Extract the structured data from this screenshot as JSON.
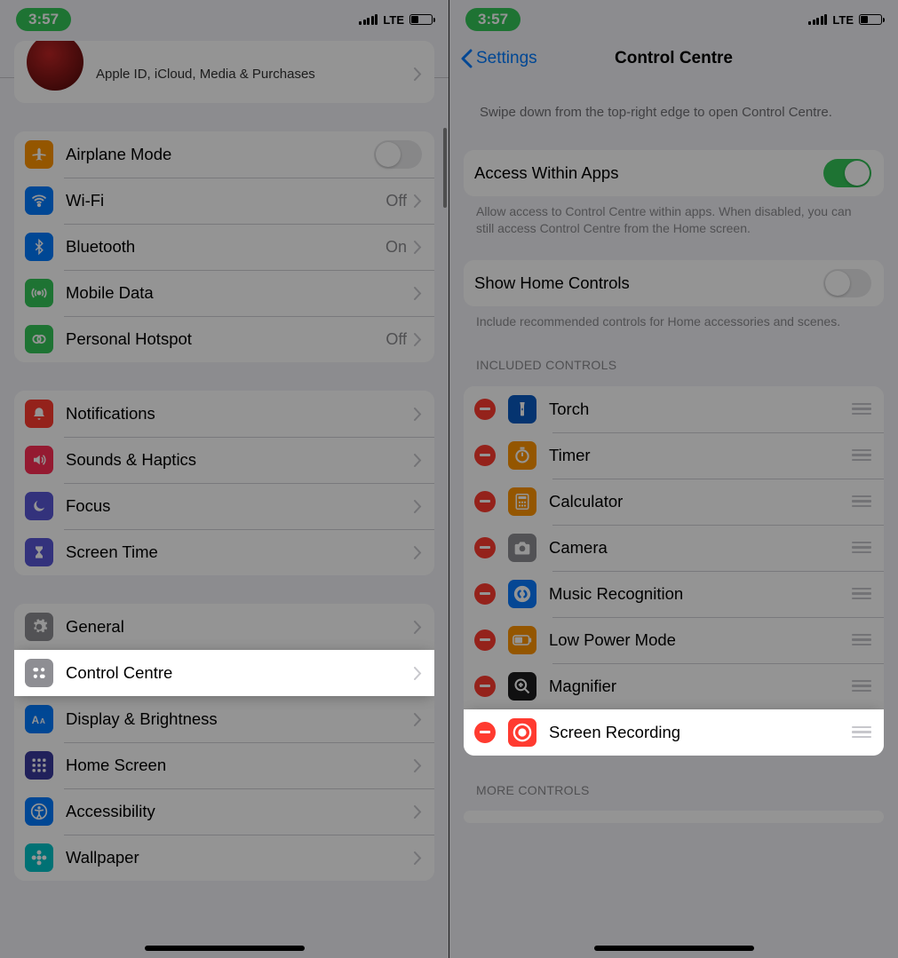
{
  "status": {
    "time": "3:57",
    "carrier": "LTE"
  },
  "left": {
    "title": "Settings",
    "profile_sub": "Apple ID, iCloud, Media & Purchases",
    "group1": [
      {
        "label": "Airplane Mode",
        "icon": "airplane",
        "bg": "#ff9500",
        "switch": false
      },
      {
        "label": "Wi-Fi",
        "icon": "wifi",
        "bg": "#007aff",
        "value": "Off"
      },
      {
        "label": "Bluetooth",
        "icon": "bluetooth",
        "bg": "#007aff",
        "value": "On"
      },
      {
        "label": "Mobile Data",
        "icon": "antenna",
        "bg": "#34c759"
      },
      {
        "label": "Personal Hotspot",
        "icon": "hotspot",
        "bg": "#34c759",
        "value": "Off"
      }
    ],
    "group2": [
      {
        "label": "Notifications",
        "icon": "bell",
        "bg": "#ff3b30"
      },
      {
        "label": "Sounds & Haptics",
        "icon": "speaker",
        "bg": "#ff2d55"
      },
      {
        "label": "Focus",
        "icon": "moon",
        "bg": "#5856d6"
      },
      {
        "label": "Screen Time",
        "icon": "hourglass",
        "bg": "#5856d6"
      }
    ],
    "group3": [
      {
        "label": "General",
        "icon": "gear",
        "bg": "#8e8e93"
      },
      {
        "label": "Control Centre",
        "icon": "controls",
        "bg": "#8e8e93",
        "highlight": true
      },
      {
        "label": "Display & Brightness",
        "icon": "text-size",
        "bg": "#007aff"
      },
      {
        "label": "Home Screen",
        "icon": "grid",
        "bg": "#3a3a9e"
      },
      {
        "label": "Accessibility",
        "icon": "accessibility",
        "bg": "#007aff"
      },
      {
        "label": "Wallpaper",
        "icon": "flower",
        "bg": "#00c3c9"
      }
    ]
  },
  "right": {
    "back": "Settings",
    "title": "Control Centre",
    "intro": "Swipe down from the top-right edge to open Control Centre.",
    "access_label": "Access Within Apps",
    "access_on": true,
    "access_footer": "Allow access to Control Centre within apps. When disabled, you can still access Control Centre from the Home screen.",
    "home_label": "Show Home Controls",
    "home_on": false,
    "home_footer": "Include recommended controls for Home accessories and scenes.",
    "included_header": "Included Controls",
    "controls": [
      {
        "label": "Torch",
        "bg": "#0a5ac2",
        "icon": "torch"
      },
      {
        "label": "Timer",
        "bg": "#ff9500",
        "icon": "timer"
      },
      {
        "label": "Calculator",
        "bg": "#ff9500",
        "icon": "calculator"
      },
      {
        "label": "Camera",
        "bg": "#8e8e93",
        "icon": "camera"
      },
      {
        "label": "Music Recognition",
        "bg": "#0a7aff",
        "icon": "shazam"
      },
      {
        "label": "Low Power Mode",
        "bg": "#ff9500",
        "icon": "battery"
      },
      {
        "label": "Magnifier",
        "bg": "#1c1c1e",
        "icon": "magnifier"
      },
      {
        "label": "Screen Recording",
        "bg": "#ff3b30",
        "icon": "record",
        "highlight": true
      }
    ],
    "more_header": "More Controls"
  }
}
